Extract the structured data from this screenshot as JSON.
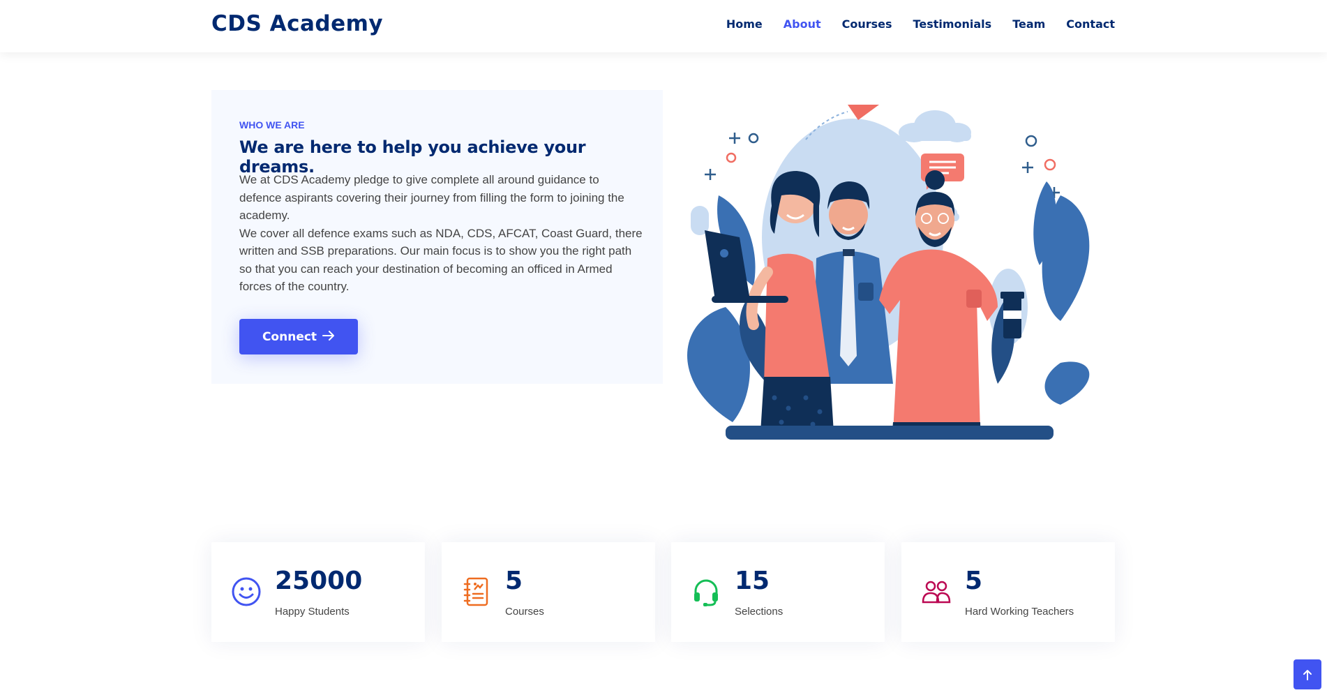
{
  "header": {
    "logo": "CDS Academy",
    "nav": [
      {
        "label": "Home",
        "active": false
      },
      {
        "label": "About",
        "active": true
      },
      {
        "label": "Courses",
        "active": false
      },
      {
        "label": "Testimonials",
        "active": false
      },
      {
        "label": "Team",
        "active": false
      },
      {
        "label": "Contact",
        "active": false
      }
    ]
  },
  "about": {
    "eyebrow": "WHO WE ARE",
    "title": "We are here to help you achieve your dreams.",
    "paragraph1": "We at CDS Academy pledge to give complete all around guidance to defence aspirants covering their journey from filling the form to joining the academy.",
    "paragraph2": "We cover all defence exams such as NDA, CDS, AFCAT, Coast Guard, there written and SSB preparations. Our main focus is to show you the right path so that you can reach your destination of becoming an officed in Armed forces of the country.",
    "button_label": "Connect"
  },
  "stats": [
    {
      "value": "25000",
      "label": "Happy Students",
      "icon": "emoji-smile-icon",
      "color": "#4154f1"
    },
    {
      "value": "5",
      "label": "Courses",
      "icon": "journal-richtext-icon",
      "color": "#ee6c20"
    },
    {
      "value": "15",
      "label": "Selections",
      "icon": "headset-icon",
      "color": "#15be56"
    },
    {
      "value": "5",
      "label": "Hard Working Teachers",
      "icon": "people-icon",
      "color": "#bb0852"
    }
  ],
  "colors": {
    "primary": "#4154f1",
    "heading": "#012970",
    "about_bg": "#f6f9ff"
  }
}
